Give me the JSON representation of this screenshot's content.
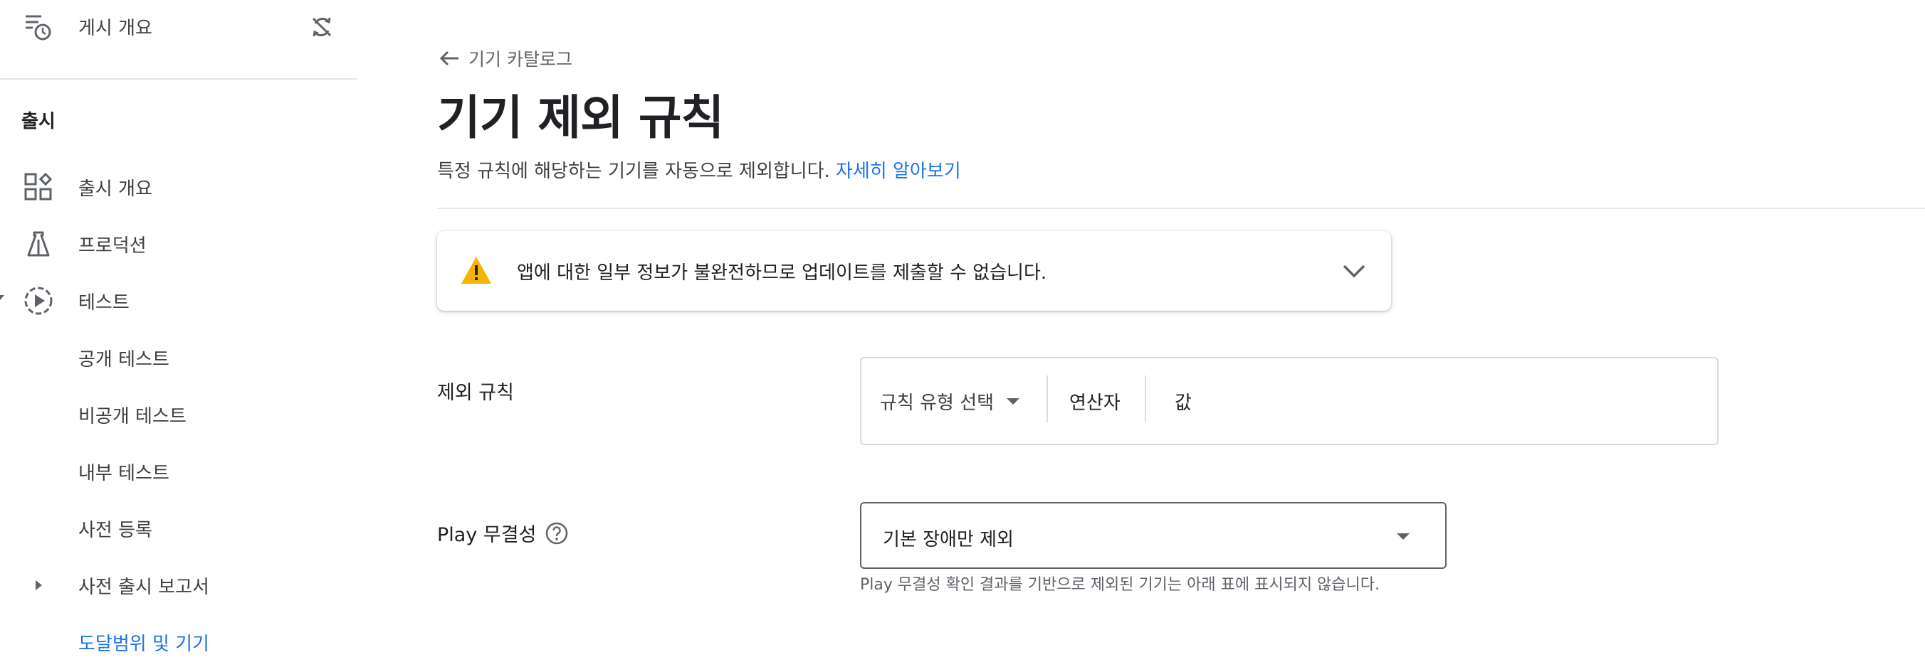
{
  "sidebar": {
    "top_item": {
      "label": "게시 개요",
      "icon": "publishing-overview-icon",
      "right_icon": "sync-off-icon"
    },
    "section_title": "출시",
    "items": [
      {
        "label": "출시 개요",
        "icon": "dashboard-icon"
      },
      {
        "label": "프로덕션",
        "icon": "production-icon"
      },
      {
        "label": "테스트",
        "icon": "testing-play-icon"
      },
      {
        "label": "공개 테스트"
      },
      {
        "label": "비공개 테스트"
      },
      {
        "label": "내부 테스트"
      },
      {
        "label": "사전 등록"
      },
      {
        "label": "사전 출시 보고서",
        "icon": "expand-arrow-icon"
      },
      {
        "label": "도달범위 및 기기"
      }
    ]
  },
  "main": {
    "back_label": "기기 카탈로그",
    "title": "기기 제외 규칙",
    "description": "특정 규칙에 해당하는 기기를 자동으로 제외합니다.",
    "learn_more": "자세히 알아보기",
    "alert": {
      "text": "앱에 대한 일부 정보가 불완전하므로 업데이트를 제출할 수 없습니다.",
      "icon": "warning-icon"
    },
    "exclusion_rules": {
      "label": "제외 규칙",
      "rule_type_placeholder": "규칙 유형 선택",
      "operator": "연산자",
      "value": "값"
    },
    "play_integrity": {
      "label": "Play 무결성",
      "selected": "기본 장애만 제외",
      "helper": "Play 무결성 확인 결과를 기반으로 제외된 기기는 아래 표에 표시되지 않습니다."
    }
  },
  "colors": {
    "link": "#1a73e8",
    "warning": "#f4b400",
    "text": "#202124",
    "muted": "#5f6368"
  }
}
